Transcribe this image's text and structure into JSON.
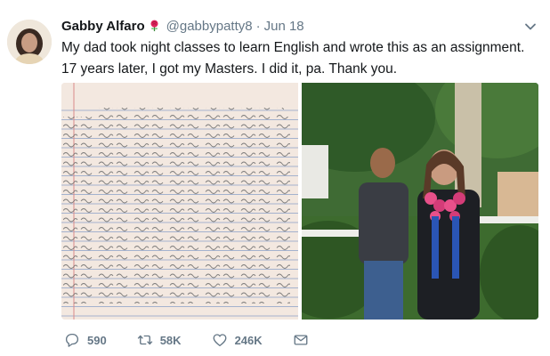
{
  "tweet": {
    "author_name": "Gabby Alfaro",
    "author_emoji": "rose-emoji",
    "handle": "@gabbypatty8",
    "separator": "·",
    "date": "Jun 18",
    "text": "My dad took night classes to learn English and wrote this as an assignment. 17 years later, I got my Masters. I did it, pa. Thank you."
  },
  "media": {
    "left_image": "handwritten-note-photo",
    "right_image": "father-daughter-graduation-photo"
  },
  "actions": {
    "reply_count": "590",
    "retweet_count": "58K",
    "like_count": "246K"
  },
  "icons": {
    "reply": "comment-icon",
    "retweet": "retweet-icon",
    "like": "heart-icon",
    "message": "envelope-icon",
    "menu": "chevron-down-icon"
  },
  "colors": {
    "text": "#14171a",
    "secondary": "#657786",
    "background": "#ffffff"
  }
}
